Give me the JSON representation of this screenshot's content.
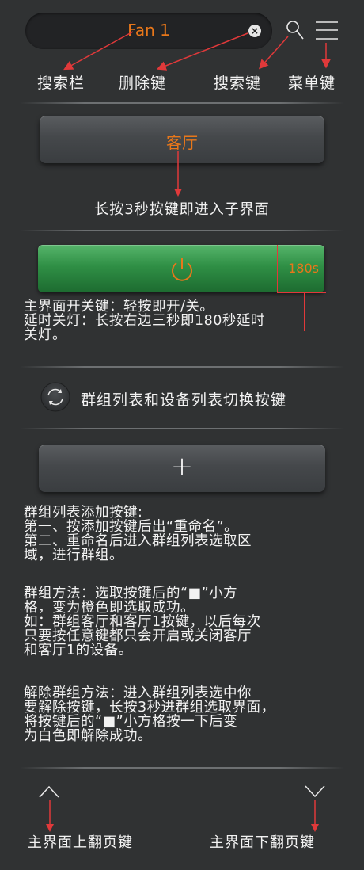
{
  "search": {
    "value": "Fan 1"
  },
  "labels": {
    "search_bar": "搜索栏",
    "delete_key": "删除键",
    "search_key": "搜索键",
    "menu_key": "菜单键"
  },
  "room_button": {
    "label": "客厅"
  },
  "room_hint": "长按3秒按键即进入子界面",
  "power_button": {
    "timer": "180s"
  },
  "power_desc": [
    "主界面开关键：轻按即开/关。",
    "延时关灯：长按右边三秒即180秒延时",
    "关灯。"
  ],
  "toggle_label": "群组列表和设备列表切换按键",
  "add_button": {
    "symbol": "+"
  },
  "add_desc": [
    "群组列表添加按键:",
    "第一、按添加按键后出“重命名”。",
    "第二、重命名后进入群组列表选取区",
    "域，进行群组。"
  ],
  "group_method": [
    "群组方法：选取按键后的“■”小方",
    "格，变为橙色即选取成功。",
    "如：群组客厅和客厅1按键，以后每次",
    "只要按任意键都只会开启或关闭客厅",
    "和客厅1的设备。"
  ],
  "ungroup_method": [
    "解除群组方法：进入群组列表选中你",
    "要解除按键，长按3秒进群组选取界面，",
    "将按键后的“■”小方格按一下后变",
    "为白色即解除成功。"
  ],
  "page_labels": {
    "up": "主界面上翻页键",
    "down": "主界面下翻页键"
  },
  "colors": {
    "accent_orange": "#e8771a",
    "annotation_red": "#e0393a",
    "power_green": "#2f8f45",
    "background": "#303233"
  },
  "icons": [
    "search-icon",
    "menu-icon",
    "clear-icon",
    "power-icon",
    "refresh-icon",
    "chevron-up-icon",
    "chevron-down-icon"
  ]
}
